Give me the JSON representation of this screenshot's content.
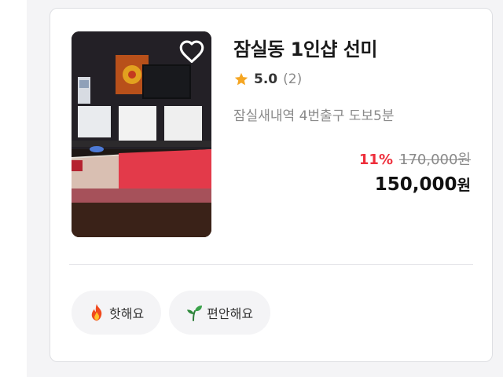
{
  "listing": {
    "title": "잠실동 1인샵 선미",
    "rating": "5.0",
    "review_count": "(2)",
    "location": "잠실새내역 4번출구 도보5분",
    "discount": "11%",
    "original_price": "170,000원",
    "price_value": "150,000",
    "price_unit": "원",
    "favorite_icon": "heart-outline-icon",
    "rating_icon": "star-icon",
    "star_color": "#f5a623",
    "discount_color": "#ee2e3b"
  },
  "tags": [
    {
      "label": "핫해요",
      "icon": "fire-icon"
    },
    {
      "label": "편안해요",
      "icon": "sprout-icon"
    }
  ]
}
